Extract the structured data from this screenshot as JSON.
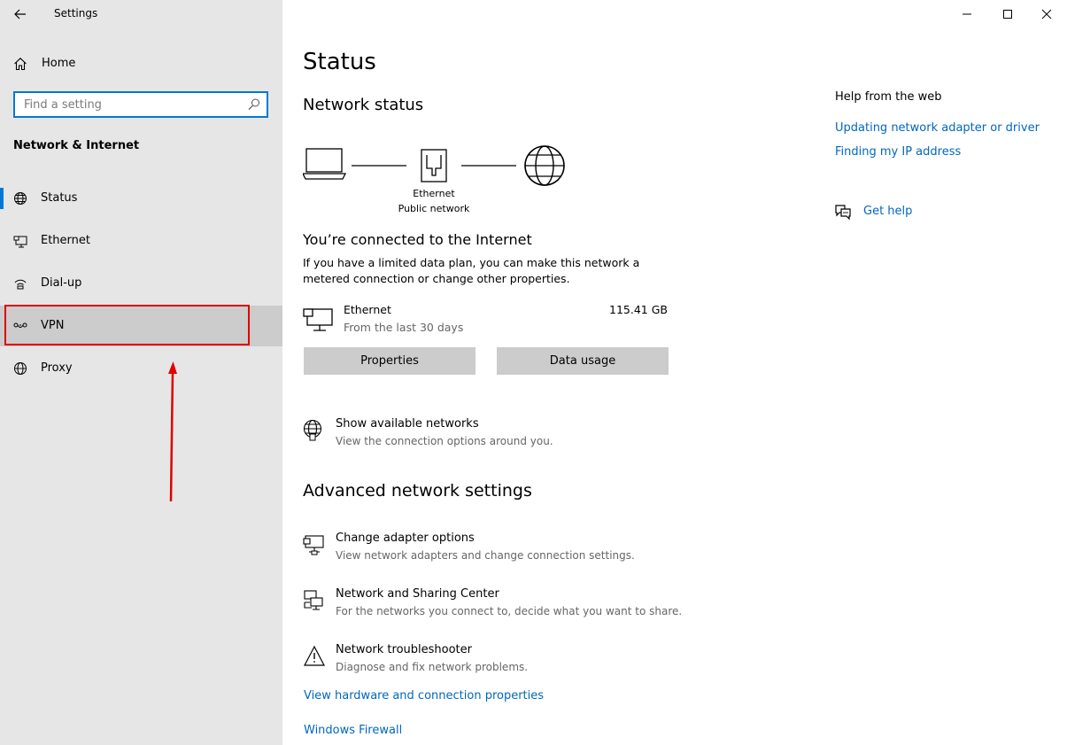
{
  "window": {
    "title": "Settings",
    "minimize_glyph": "—",
    "maximize_glyph": "☐",
    "close_glyph": "✕"
  },
  "sidebar": {
    "home_label": "Home",
    "search_placeholder": "Find a setting",
    "section_title": "Network & Internet",
    "items": [
      {
        "label": "Status",
        "icon": "globe-status-icon",
        "active": true
      },
      {
        "label": "Ethernet",
        "icon": "ethernet-icon"
      },
      {
        "label": "Dial-up",
        "icon": "dialup-icon"
      },
      {
        "label": "VPN",
        "icon": "vpn-icon",
        "highlighted": true
      },
      {
        "label": "Proxy",
        "icon": "globe-icon"
      }
    ]
  },
  "main": {
    "title": "Status",
    "network_status_header": "Network status",
    "diagram": {
      "adapter_label": "Ethernet",
      "network_label": "Public network"
    },
    "connected_title": "You’re connected to the Internet",
    "connected_desc": "If you have a limited data plan, you can make this network a metered connection or change other properties.",
    "ethernet": {
      "name": "Ethernet",
      "period": "From the last 30 days",
      "usage": "115.41 GB"
    },
    "buttons": {
      "properties": "Properties",
      "data_usage": "Data usage"
    },
    "show_networks": {
      "title": "Show available networks",
      "desc": "View the connection options around you."
    },
    "advanced_header": "Advanced network settings",
    "advanced_items": [
      {
        "title": "Change adapter options",
        "desc": "View network adapters and change connection settings."
      },
      {
        "title": "Network and Sharing Center",
        "desc": "For the networks you connect to, decide what you want to share."
      },
      {
        "title": "Network troubleshooter",
        "desc": "Diagnose and fix network problems."
      }
    ],
    "links": {
      "hardware": "View hardware and connection properties",
      "firewall": "Windows Firewall"
    }
  },
  "help": {
    "title": "Help from the web",
    "links": [
      "Updating network adapter or driver",
      "Finding my IP address"
    ],
    "get_help": "Get help"
  },
  "colors": {
    "accent": "#0078d7",
    "link": "#0067c0",
    "sidebar_bg": "#e6e6e6",
    "highlight": "#e00000"
  }
}
